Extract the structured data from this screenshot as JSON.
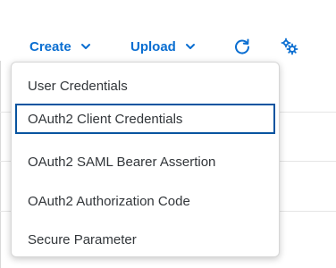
{
  "toolbar": {
    "create_label": "Create",
    "upload_label": "Upload",
    "refresh_icon": "refresh-icon",
    "settings_icon": "settings-icon"
  },
  "menu": {
    "items": [
      {
        "label": "User Credentials",
        "focused": false
      },
      {
        "label": "OAuth2 Client Credentials",
        "focused": true
      },
      {
        "label": "OAuth2 SAML Bearer Assertion",
        "focused": false
      },
      {
        "label": "OAuth2 Authorization Code",
        "focused": false
      },
      {
        "label": "Secure Parameter",
        "focused": false
      }
    ]
  },
  "colors": {
    "accent": "#0a6ed1",
    "focus_border": "#0854a0",
    "menu_text": "#32363a"
  }
}
